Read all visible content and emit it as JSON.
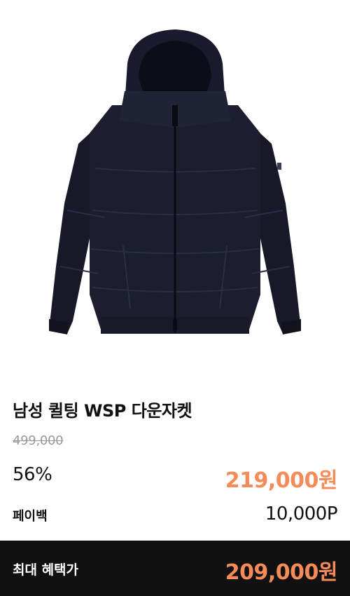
{
  "product": {
    "title": "남성 퀼팅 WSP 다운자켓",
    "original_price": "499,000",
    "discount_rate": "56%",
    "sale_price": "219,000원",
    "payback_label": "페이백",
    "payback_value": "10,000P",
    "image_icon": "down-jacket-image"
  },
  "benefit": {
    "label": "최대 혜택가",
    "price": "209,000원"
  },
  "colors": {
    "accent": "#f58b58",
    "bar_background": "#111111",
    "jacket": "#1b1d2e"
  }
}
